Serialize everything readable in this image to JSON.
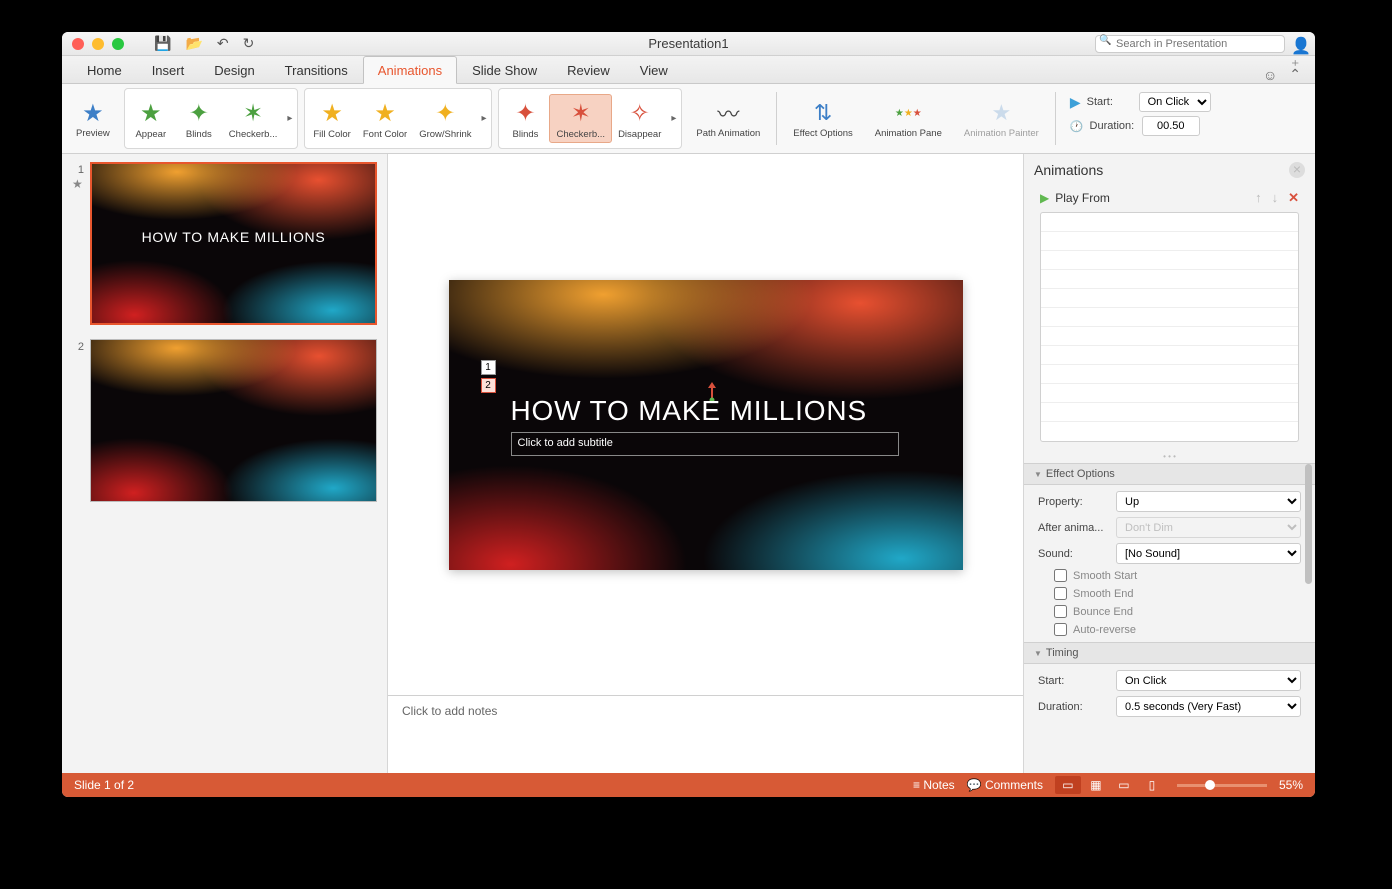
{
  "window": {
    "title": "Presentation1"
  },
  "search": {
    "placeholder": "Search in Presentation"
  },
  "tabs": {
    "items": [
      "Home",
      "Insert",
      "Design",
      "Transitions",
      "Animations",
      "Slide Show",
      "Review",
      "View"
    ],
    "active": "Animations"
  },
  "ribbon": {
    "preview": "Preview",
    "entrance": [
      {
        "label": "Appear",
        "color": "green"
      },
      {
        "label": "Blinds",
        "color": "green"
      },
      {
        "label": "Checkerb...",
        "color": "green"
      }
    ],
    "emphasis": [
      {
        "label": "Fill Color",
        "color": "yellow"
      },
      {
        "label": "Font Color",
        "color": "yellow"
      },
      {
        "label": "Grow/Shrink",
        "color": "yellow"
      }
    ],
    "exit": [
      {
        "label": "Blinds",
        "color": "red"
      },
      {
        "label": "Checkerb...",
        "color": "red",
        "selected": true
      },
      {
        "label": "Disappear",
        "color": "red"
      }
    ],
    "path": "Path\nAnimation",
    "effect_options": "Effect\nOptions",
    "anim_pane": "Animation\nPane",
    "anim_painter": "Animation\nPainter",
    "start_label": "Start:",
    "start_value": "On Click",
    "duration_label": "Duration:",
    "duration_value": "00.50"
  },
  "thumbs": [
    {
      "num": "1",
      "title": "HOW TO MAKE MILLIONS",
      "active": true,
      "starred": true
    },
    {
      "num": "2",
      "title": "",
      "active": false,
      "starred": false
    }
  ],
  "slide": {
    "title": "HOW TO MAKE MILLIONS",
    "subtitle_placeholder": "Click to add subtitle",
    "anim_badges": [
      "1",
      "2"
    ],
    "selected_badge": "2"
  },
  "notes_placeholder": "Click to add notes",
  "apane": {
    "title": "Animations",
    "play_from": "Play From",
    "sections": {
      "effect_options": "Effect Options",
      "timing": "Timing"
    },
    "property_label": "Property:",
    "property_value": "Up",
    "after_label": "After anima...",
    "after_value": "Don't Dim",
    "sound_label": "Sound:",
    "sound_value": "[No Sound]",
    "checks": [
      "Smooth Start",
      "Smooth End",
      "Bounce End",
      "Auto-reverse"
    ],
    "t_start_label": "Start:",
    "t_start_value": "On Click",
    "t_duration_label": "Duration:",
    "t_duration_value": "0.5 seconds (Very Fast)"
  },
  "status": {
    "slide": "Slide 1 of 2",
    "notes": "Notes",
    "comments": "Comments",
    "zoom": "55%"
  }
}
